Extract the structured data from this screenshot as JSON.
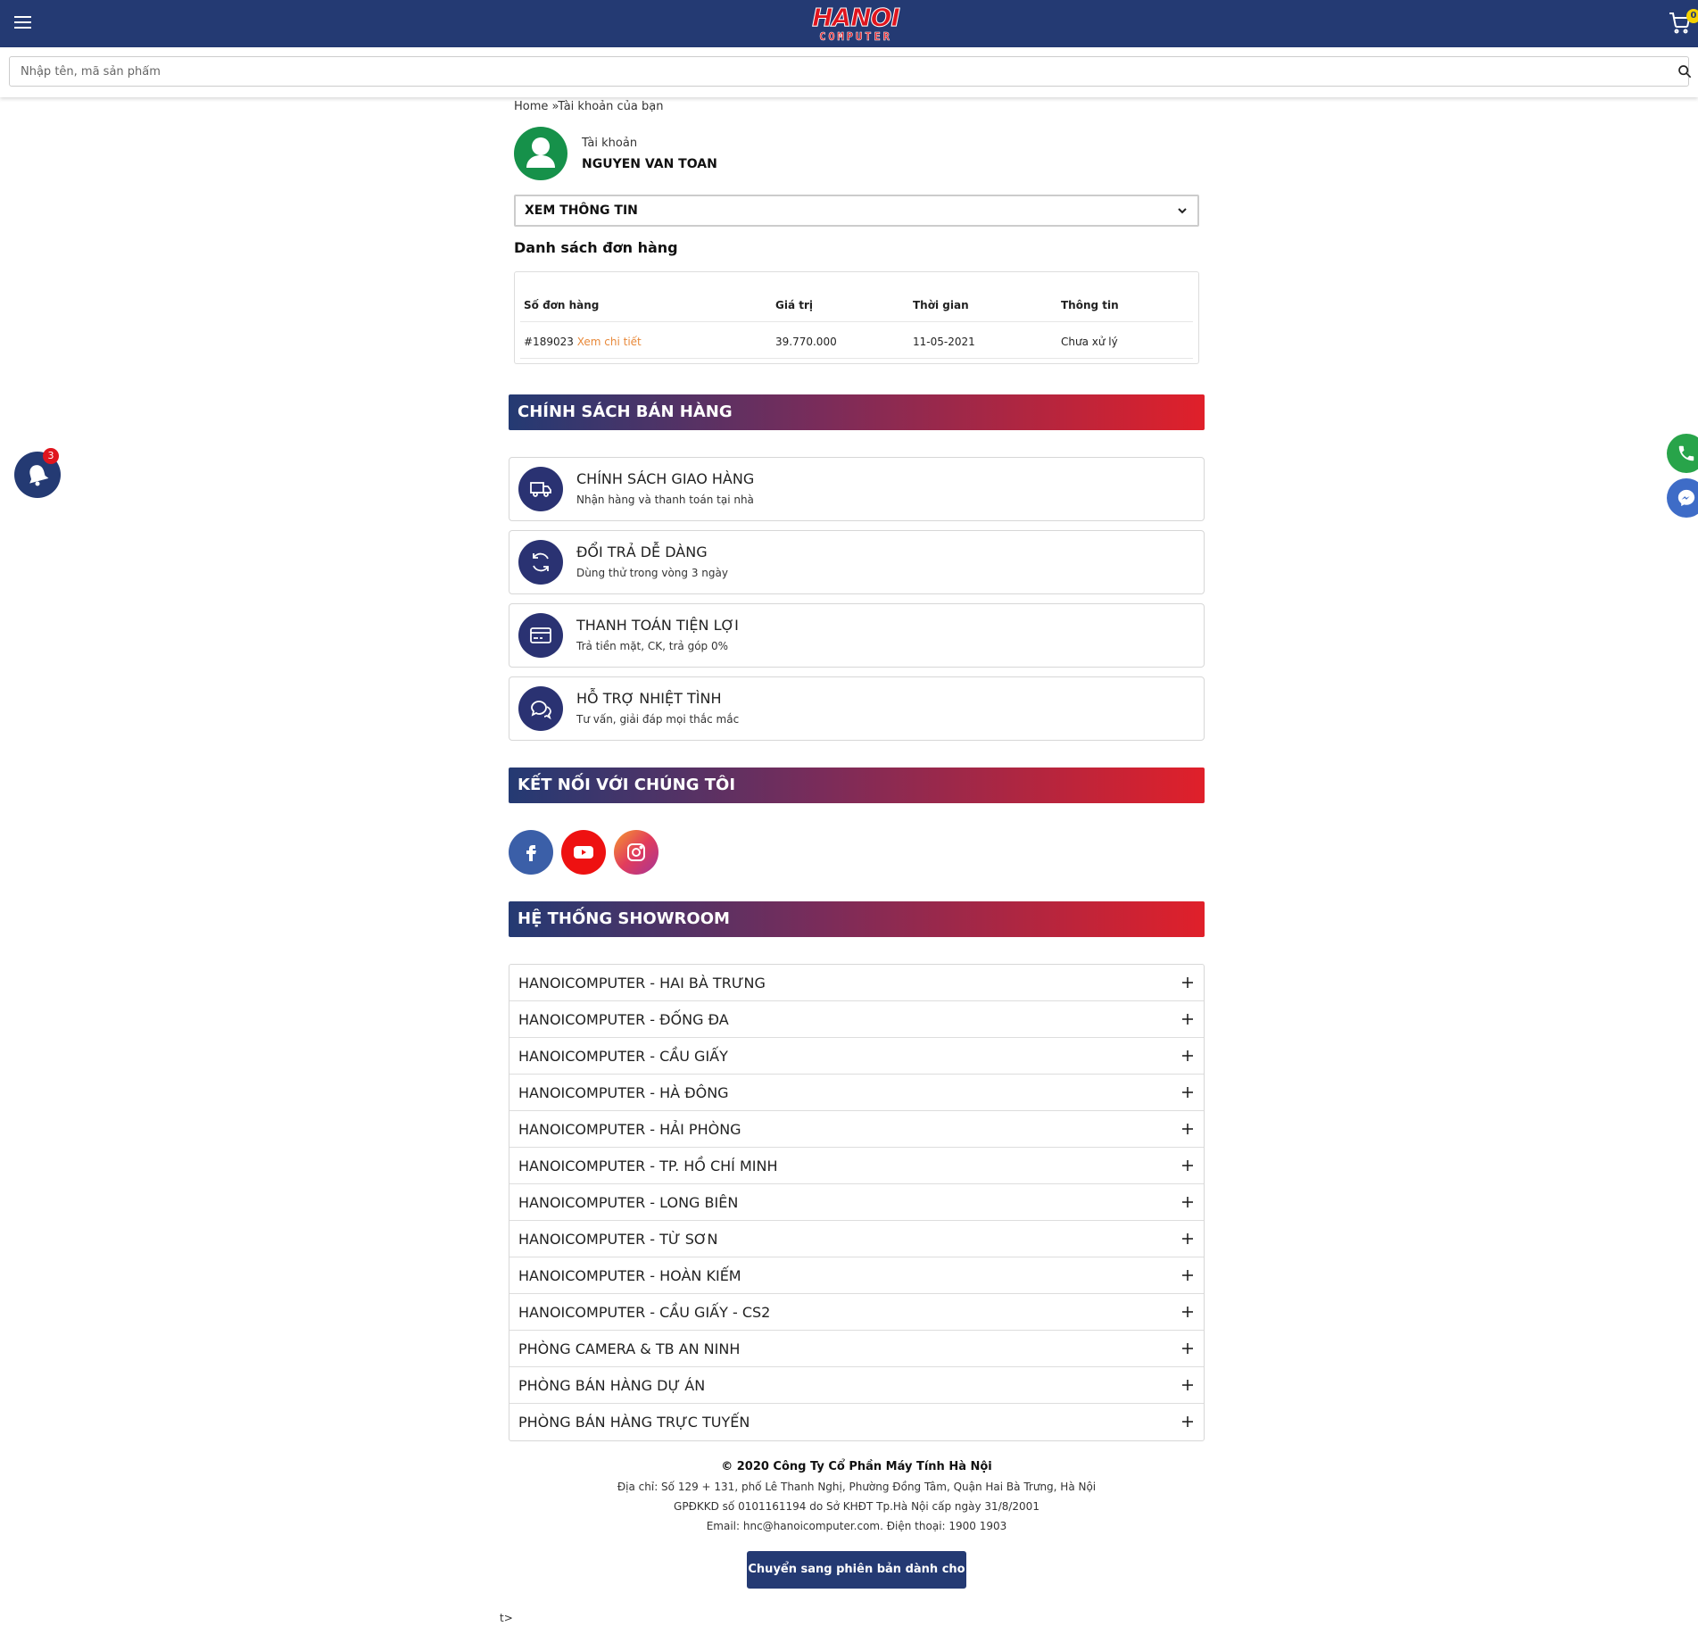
{
  "header": {
    "logo_top": "HANOI",
    "logo_bottom": "COMPUTER",
    "cart_count": "0",
    "brand_color": "#243a73",
    "accent_color": "#e0151e"
  },
  "search": {
    "placeholder": "Nhập tên, mã sản phẩm"
  },
  "breadcrumb": {
    "home": "Home",
    "separator": " »",
    "current": "Tài khoản của bạn"
  },
  "account": {
    "label": "Tài khoản",
    "name": "NGUYEN VAN TOAN",
    "select_value": "XEM THÔNG TIN"
  },
  "orders": {
    "title": "Danh sách đơn hàng",
    "columns": [
      "Số đơn hàng",
      "Giá trị",
      "Thời gian",
      "Thông tin"
    ],
    "rows": [
      {
        "order_no": "#189023",
        "detail_link": "Xem chi tiết",
        "value": "39.770.000",
        "date": "11-05-2021",
        "status": "Chưa xử lý"
      }
    ]
  },
  "policy_section": {
    "title": "CHÍNH SÁCH BÁN HÀNG",
    "items": [
      {
        "icon": "truck-icon",
        "title": "CHÍNH SÁCH GIAO HÀNG",
        "subtitle": "Nhận hàng và thanh toán tại nhà"
      },
      {
        "icon": "refresh-icon",
        "title": "ĐỔI TRẢ DỄ DÀNG",
        "subtitle": "Dùng thử trong vòng 3 ngày"
      },
      {
        "icon": "credit-card-icon",
        "title": "THANH TOÁN TIỆN LỢI",
        "subtitle": "Trả tiền mặt, CK, trả góp 0%"
      },
      {
        "icon": "chat-icon",
        "title": "HỖ TRỢ NHIỆT TÌNH",
        "subtitle": "Tư vấn, giải đáp mọi thắc mắc"
      }
    ]
  },
  "connect_section": {
    "title": "KẾT NỐI VỚI CHÚNG TÔI",
    "socials": [
      "facebook-icon",
      "youtube-icon",
      "instagram-icon"
    ]
  },
  "showroom_section": {
    "title": "HỆ THỐNG SHOWROOM",
    "items": [
      "HANOICOMPUTER - HAI BÀ TRƯNG",
      "HANOICOMPUTER - ĐỐNG ĐA",
      "HANOICOMPUTER - CẦU GIẤY",
      "HANOICOMPUTER - HÀ ĐÔNG",
      "HANOICOMPUTER - HẢI PHÒNG",
      "HANOICOMPUTER - TP. HỒ CHÍ MINH",
      "HANOICOMPUTER - LONG BIÊN",
      "HANOICOMPUTER - TỪ SƠN",
      "HANOICOMPUTER - HOÀN KIẾM",
      "HANOICOMPUTER - CẦU GIẤY - CS2",
      "PHÒNG CAMERA & TB AN NINH",
      "PHÒNG BÁN HÀNG DỰ ÁN",
      "PHÒNG BÁN HÀNG TRỰC TUYẾN"
    ]
  },
  "footer": {
    "company": "© 2020 Công Ty Cổ Phần Máy Tính Hà Nội",
    "address": "Địa chỉ: Số 129 + 131, phố Lê Thanh Nghị, Phường Đồng Tâm, Quận Hai Bà Trưng, Hà Nội",
    "license": "GPĐKKD số 0101161194 do Sở KHĐT Tp.Hà Nội cấp ngày 31/8/2001",
    "contact": "Email: hnc@hanoicomputer.com. Điện thoại: 1900 1903",
    "pc_button": "Chuyển sang phiên bản dành cho PC",
    "stray_text": "t>"
  },
  "notifications": {
    "count": "3"
  }
}
